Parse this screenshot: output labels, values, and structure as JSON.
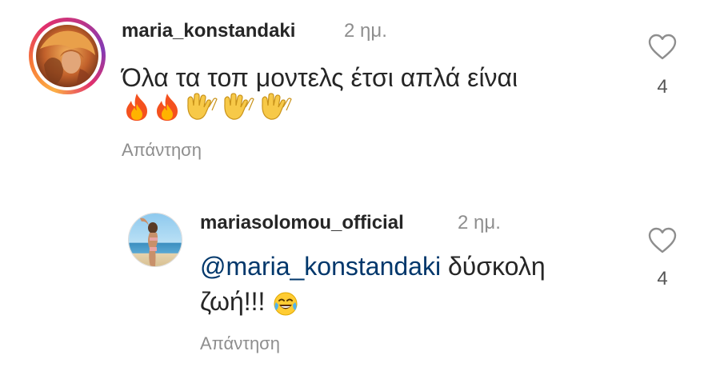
{
  "comments": [
    {
      "username": "maria_konstandaki",
      "time": "2 ημ.",
      "text_line1": "Όλα τα τοπ μοντελς έτσι απλά είναι",
      "emoji_line2": [
        "fire-emoji",
        "fire-emoji",
        "clapping-hands-emoji",
        "clapping-hands-emoji",
        "clapping-hands-emoji"
      ],
      "reply_label": "Απάντηση",
      "like_icon": "heart-outline-icon",
      "like_count": "4"
    },
    {
      "username": "mariasolomou_official",
      "time": "2 ημ.",
      "mention": "@maria_konstandaki",
      "text_line1_rest": " δύσκολη",
      "text_line2": "ζωή!!!",
      "emoji_line2": [
        "tears-of-joy-emoji"
      ],
      "reply_label": "Απάντηση",
      "like_icon": "heart-outline-icon",
      "like_count": "4"
    }
  ]
}
